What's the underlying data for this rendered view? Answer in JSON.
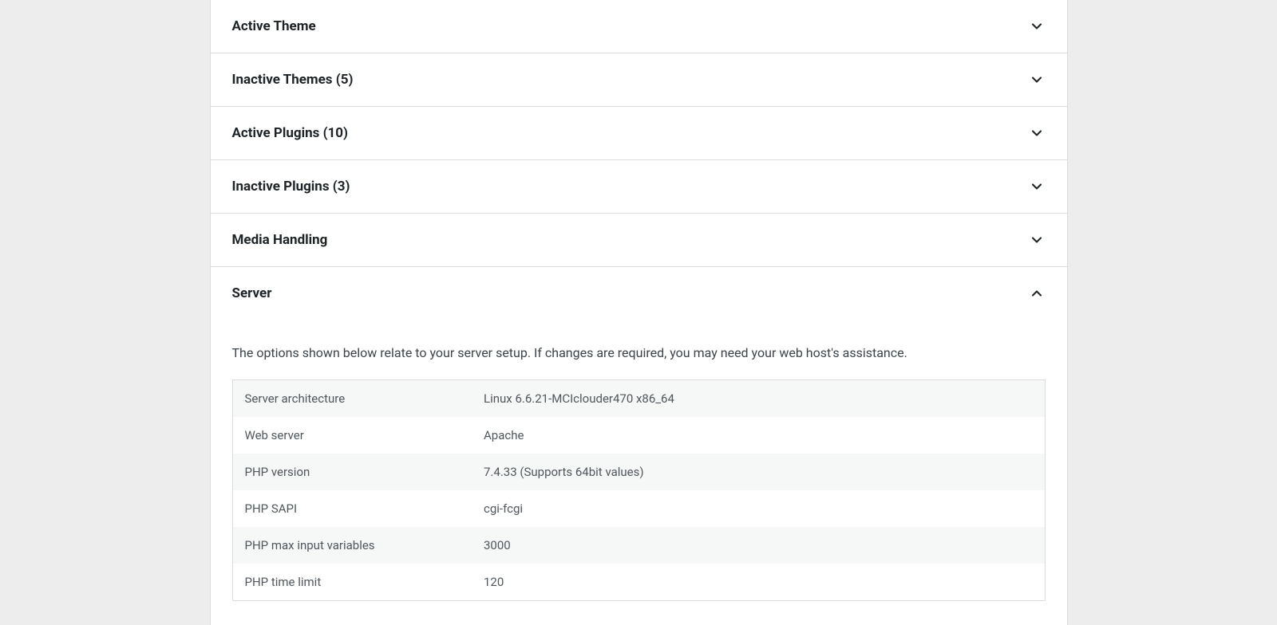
{
  "panels": {
    "activeTheme": {
      "title": "Active Theme"
    },
    "inactiveThemes": {
      "title": "Inactive Themes (5)"
    },
    "activePlugins": {
      "title": "Active Plugins (10)"
    },
    "inactivePlugins": {
      "title": "Inactive Plugins (3)"
    },
    "mediaHandling": {
      "title": "Media Handling"
    },
    "server": {
      "title": "Server",
      "description": "The options shown below relate to your server setup. If changes are required, you may need your web host's assistance.",
      "rows": [
        {
          "label": "Server architecture",
          "value": "Linux 6.6.21-MCIclouder470 x86_64"
        },
        {
          "label": "Web server",
          "value": "Apache"
        },
        {
          "label": "PHP version",
          "value": "7.4.33 (Supports 64bit values)"
        },
        {
          "label": "PHP SAPI",
          "value": "cgi-fcgi"
        },
        {
          "label": "PHP max input variables",
          "value": "3000"
        },
        {
          "label": "PHP time limit",
          "value": "120"
        }
      ]
    }
  }
}
